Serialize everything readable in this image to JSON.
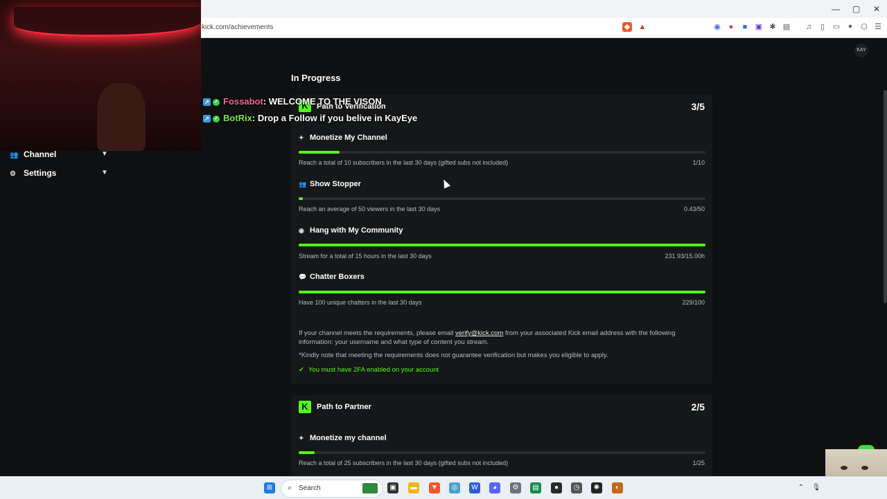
{
  "browser": {
    "url": "kick.com/achievements",
    "window_controls": [
      "—",
      "▢",
      "✕"
    ]
  },
  "sidebar": {
    "items": [
      {
        "label": "Channel",
        "icon": "users-icon"
      },
      {
        "label": "Settings",
        "icon": "gear-icon"
      }
    ]
  },
  "chat_overlay": [
    {
      "user": "Fossabot",
      "message": ": WELCOME TO THE VISON"
    },
    {
      "user": "BotRix",
      "message": ": Drop a Follow if you belive in KayEye"
    }
  ],
  "main": {
    "section_title": "In Progress",
    "verification": {
      "title": "Path to Verification",
      "count": "3/5",
      "requirements": [
        {
          "title": "Monetize My Channel",
          "icon": "sparkle-icon",
          "desc": "Reach a total of 10 subscribers in the last 30 days (gifted subs not included)",
          "value": "1/10",
          "progress": 0.1
        },
        {
          "title": "Show Stopper",
          "icon": "users-icon",
          "desc": "Reach an average of 50 viewers in the last 30 days",
          "value": "0.43/50",
          "progress": 0.0086
        },
        {
          "title": "Hang with My Community",
          "icon": "broadcast-icon",
          "desc": "Stream for a total of 15 hours in the last 30 days",
          "value": "231.93/15.00h",
          "progress": 1.0
        },
        {
          "title": "Chatter Boxers",
          "icon": "chat-icon",
          "desc": "Have 100 unique chatters in the last 30 days",
          "value": "229/100",
          "progress": 1.0
        }
      ],
      "info_before": "If your channel meets the requirements, please email ",
      "info_email": "verify@kick.com",
      "info_after": " from your associated Kick email address with the following information: your username and what type of content you stream.",
      "note": "*Kindly note that meeting the requirements does not guarantee verification but makes you eligible to apply.",
      "twofa": "You must have 2FA enabled on your account"
    },
    "partner": {
      "title": "Path to Partner",
      "count": "2/5",
      "requirements": [
        {
          "title": "Monetize my channel",
          "icon": "sparkle-icon",
          "desc": "Reach a total of 25 subscribers in the last 30 days (gifted subs not included)",
          "value": "1/25",
          "progress": 0.04
        }
      ]
    }
  },
  "taskbar": {
    "search_placeholder": "Search"
  },
  "colors": {
    "accent": "#53fc18",
    "background": "#0f1011",
    "card": "#151718"
  }
}
